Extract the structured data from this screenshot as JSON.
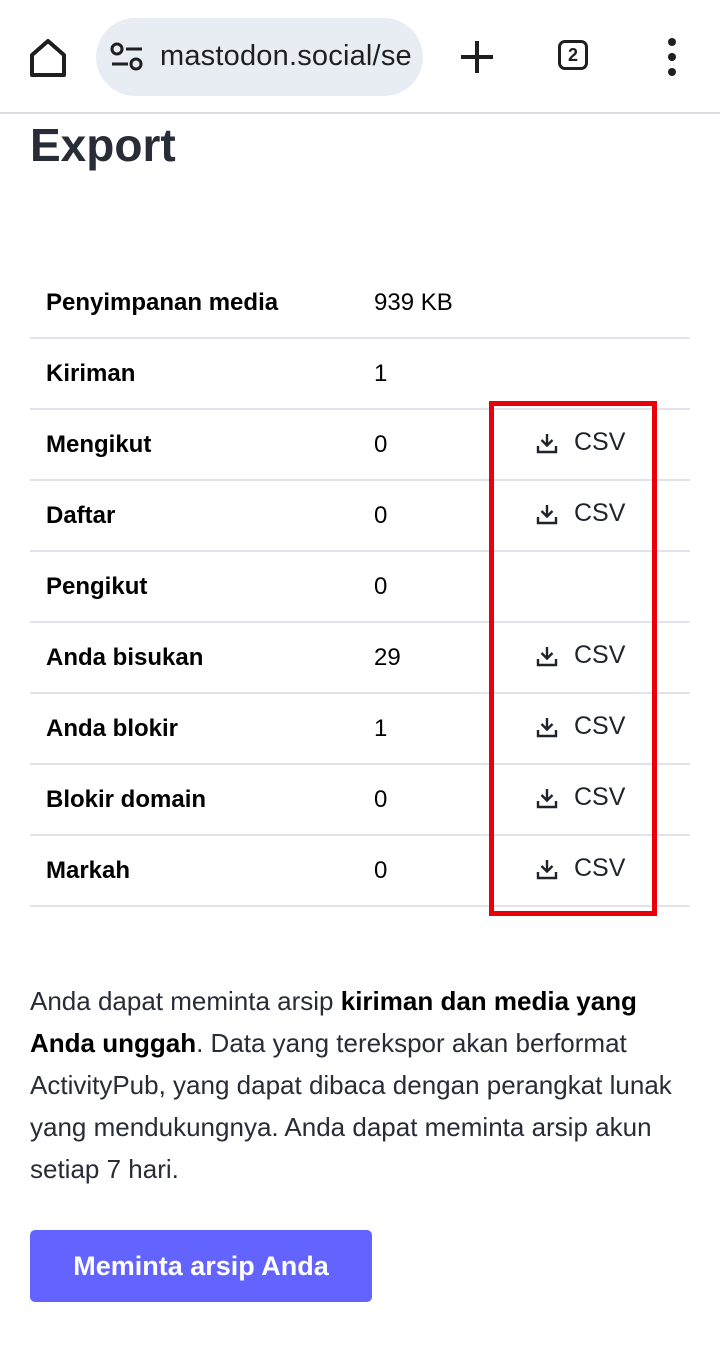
{
  "browser": {
    "url": "mastodon.social/se",
    "tab_count": "2",
    "icons": {
      "home": "home-icon",
      "site_settings": "tune-icon",
      "new_tab": "plus-icon",
      "menu": "more-vert-icon"
    }
  },
  "page": {
    "title": "Export"
  },
  "table": {
    "rows": [
      {
        "label": "Penyimpanan media",
        "value": "939 KB",
        "action": ""
      },
      {
        "label": "Kiriman",
        "value": "1",
        "action": ""
      },
      {
        "label": "Mengikut",
        "value": "0",
        "action": "CSV"
      },
      {
        "label": "Daftar",
        "value": "0",
        "action": "CSV"
      },
      {
        "label": "Pengikut",
        "value": "0",
        "action": ""
      },
      {
        "label": "Anda bisukan",
        "value": "29",
        "action": "CSV"
      },
      {
        "label": "Anda blokir",
        "value": "1",
        "action": "CSV"
      },
      {
        "label": "Blokir domain",
        "value": "0",
        "action": "CSV"
      },
      {
        "label": "Markah",
        "value": "0",
        "action": "CSV"
      }
    ]
  },
  "description": {
    "part1": "Anda dapat meminta arsip ",
    "bold": "kiriman dan media yang Anda unggah",
    "part2": ". Data yang terekspor akan berformat ActivityPub, yang dapat dibaca dengan perangkat lunak yang mendukungnya. Anda dapat meminta arsip akun setiap 7 hari."
  },
  "archive_button": {
    "label": "Meminta arsip Anda"
  },
  "colors": {
    "accent": "#6364ff",
    "highlight": "#e8000b",
    "title": "#282c37"
  }
}
